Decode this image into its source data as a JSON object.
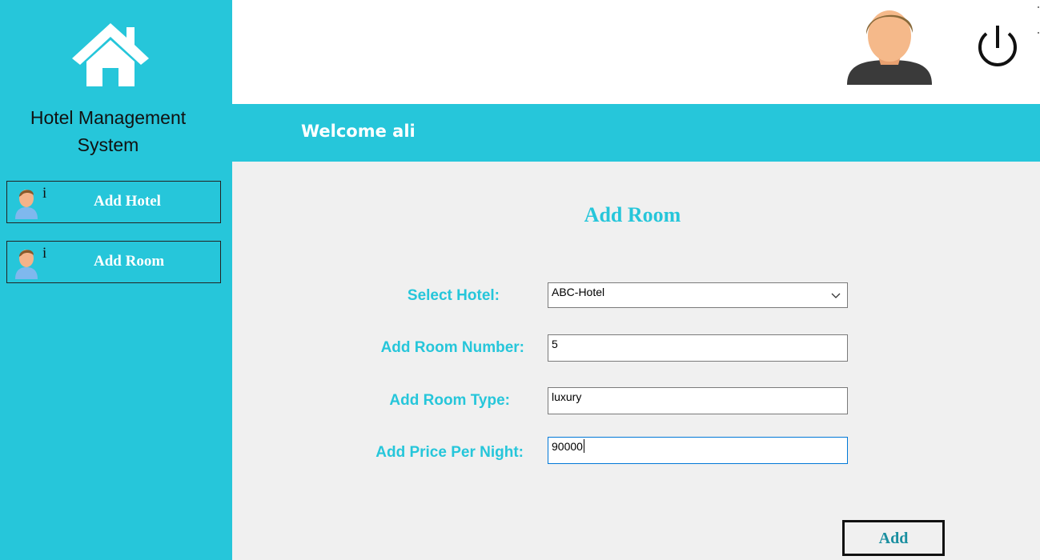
{
  "sidebar": {
    "app_title_line1": "Hotel Management",
    "app_title_line2": "System",
    "items": [
      {
        "label": "Add Hotel",
        "icon": "user-info-icon",
        "glyph": "i"
      },
      {
        "label": "Add Room",
        "icon": "user-info-icon",
        "glyph": "i"
      }
    ]
  },
  "header": {
    "welcome": "Welcome ali",
    "icons": [
      "user-avatar-icon",
      "power-icon"
    ]
  },
  "form": {
    "title": "Add Room",
    "select_hotel_label": "Select Hotel:",
    "select_hotel_value": "ABC-Hotel",
    "room_number_label": "Add Room Number:",
    "room_number_value": "5",
    "room_type_label": "Add Room Type:",
    "room_type_value": "luxury",
    "price_label": "Add Price Per Night:",
    "price_value": "90000",
    "submit_label": "Add"
  },
  "colors": {
    "accent": "#26c6da",
    "background": "#f0f0f0",
    "topbar": "#ffffff"
  }
}
